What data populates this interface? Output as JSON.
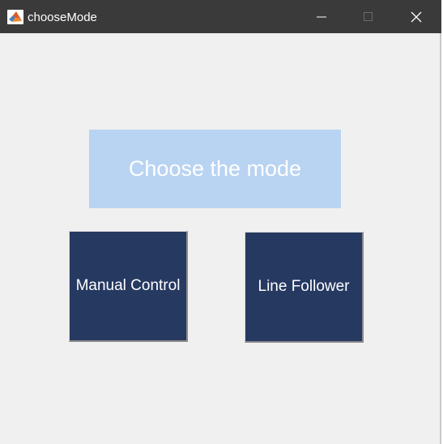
{
  "window": {
    "title": "chooseMode",
    "app_icon": "matlab-icon"
  },
  "controls": {
    "minimize_icon": "minimize-icon",
    "maximize_icon": "maximize-icon",
    "close_icon": "close-icon"
  },
  "main": {
    "heading": "Choose the mode",
    "buttons": [
      {
        "label": "Manual Control"
      },
      {
        "label": "Line Follower"
      }
    ]
  },
  "colors": {
    "titlebar": "#3a3a3a",
    "background": "#f0f0f0",
    "heading_bg": "#b9d3f2",
    "button_bg": "#263961",
    "text": "#ffffff"
  }
}
